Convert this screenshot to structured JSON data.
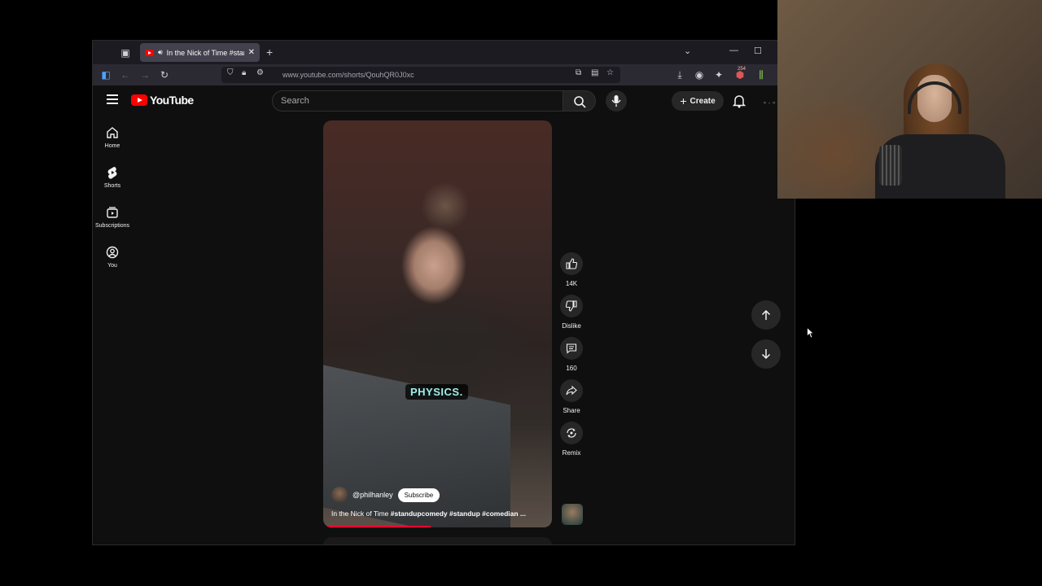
{
  "browser": {
    "tab_title": "In the Nick of Time #standu",
    "url": "www.youtube.com/shorts/QouhQR0J0xc",
    "ext_badge": "254"
  },
  "youtube": {
    "logo_text": "YouTube",
    "search_placeholder": "Search",
    "create_label": "Create",
    "sidebar": [
      {
        "label": "Home",
        "icon": "home-icon"
      },
      {
        "label": "Shorts",
        "icon": "shorts-icon"
      },
      {
        "label": "Subscriptions",
        "icon": "subscriptions-icon"
      },
      {
        "label": "You",
        "icon": "you-icon"
      }
    ]
  },
  "short": {
    "caption": "PHYSICS.",
    "channel": "@philhanley",
    "subscribe_label": "Subscribe",
    "title_plain": "In the Nick of Time ",
    "title_tags": "#standupcomedy #standup #comedian ...",
    "progress": 0.47
  },
  "actions": {
    "likes": "14K",
    "dislike_label": "Dislike",
    "comments": "160",
    "share_label": "Share",
    "remix_label": "Remix"
  },
  "colors": {
    "yt_red": "#ff0000",
    "caption_text": "#9ff0e8",
    "page_bg": "#0f0f0f"
  }
}
